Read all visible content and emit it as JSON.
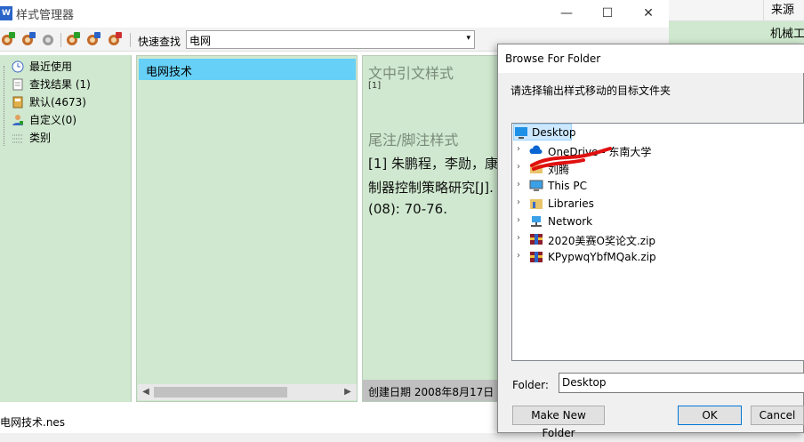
{
  "background_table": {
    "header_source": "来源",
    "row_cell": "机械工"
  },
  "window": {
    "title": "样式管理器",
    "app_icon_text": "W",
    "minimize": "—",
    "maximize": "☐",
    "close": "✕"
  },
  "toolbar": {
    "quick_find_label": "快速查找",
    "quick_find_value": "电网",
    "dropdown_arrow": "▾"
  },
  "tree": {
    "items": [
      {
        "label": "最近使用",
        "icon": "clock-icon"
      },
      {
        "label": "查找结果 (1)",
        "icon": "document-icon"
      },
      {
        "label": "默认(4673)",
        "icon": "book-icon"
      },
      {
        "label": "自定义(0)",
        "icon": "user-icon"
      },
      {
        "label": "类别",
        "icon": "grid-icon"
      }
    ]
  },
  "list": {
    "selected_item": "电网技术",
    "scroll_left": "◀",
    "scroll_right": "▶"
  },
  "preview": {
    "citation_heading": "文中引文样式",
    "citation_sample": "[1]",
    "footnote_heading": "尾注/脚注样式",
    "footnote_line1": "[1] 朱鹏程，李勋，康",
    "footnote_line2": "制器控制策略研究[J].",
    "footnote_line3": "(08): 70-76.",
    "created_date": "创建日期  2008年8月17日"
  },
  "status_bar": {
    "filename": "电网技术.nes"
  },
  "dialog": {
    "title": "Browse For Folder",
    "prompt": "请选择输出样式移动的目标文件夹",
    "nodes": [
      {
        "label": "Desktop",
        "icon": "desktop-icon",
        "expandable": false,
        "selected": true
      },
      {
        "label": "OneDrive - 东南大学",
        "icon": "cloud-icon",
        "expandable": true
      },
      {
        "label": "刘腾",
        "icon": "user-folder-icon",
        "expandable": true
      },
      {
        "label": "This PC",
        "icon": "computer-icon",
        "expandable": true
      },
      {
        "label": "Libraries",
        "icon": "library-icon",
        "expandable": true
      },
      {
        "label": "Network",
        "icon": "network-icon",
        "expandable": true
      },
      {
        "label": "2020美赛O奖论文.zip",
        "icon": "zip-icon",
        "expandable": true
      },
      {
        "label": "KPypwqYbfMQak.zip",
        "icon": "zip-icon",
        "expandable": true
      }
    ],
    "folder_label": "Folder:",
    "folder_value": "Desktop",
    "chevron": "›",
    "make_new_folder": "Make New Folder",
    "ok": "OK",
    "cancel": "Cancel"
  },
  "colors": {
    "pane_green": "#cfe8cf",
    "selection_blue": "#66d0f6",
    "accent": "#0078d7"
  }
}
